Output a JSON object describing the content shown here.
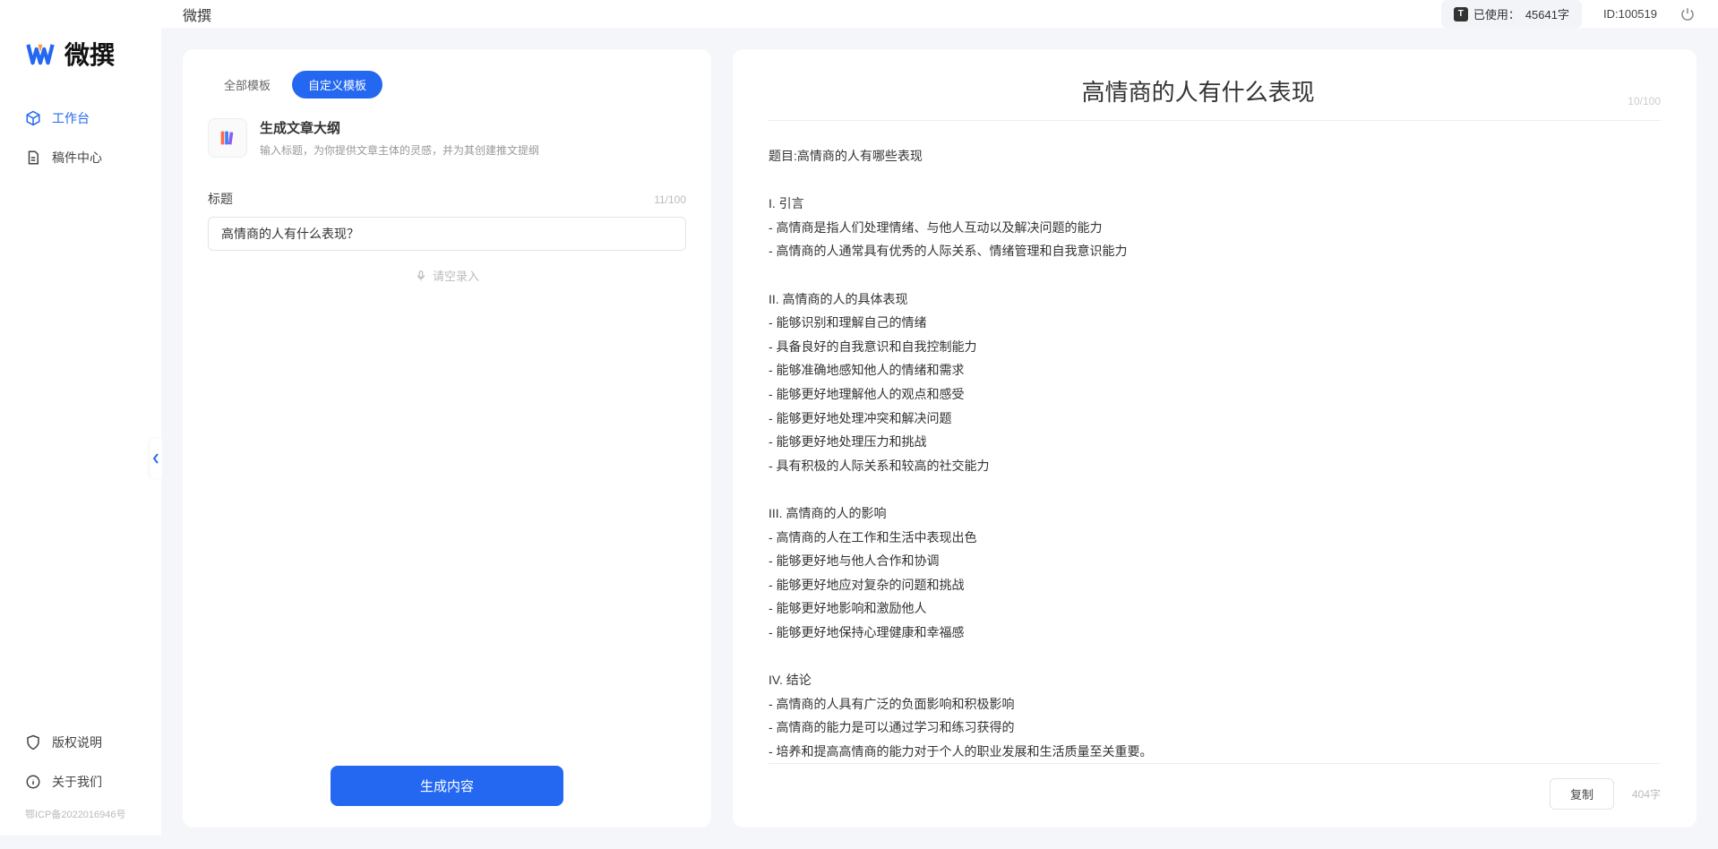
{
  "app": {
    "logo_text": "微撰",
    "title": "微撰"
  },
  "sidebar": {
    "nav": [
      {
        "label": "工作台",
        "active": true
      },
      {
        "label": "稿件中心",
        "active": false
      }
    ],
    "bottom": [
      {
        "label": "版权说明"
      },
      {
        "label": "关于我们"
      }
    ],
    "icp": "鄂ICP备2022016946号"
  },
  "topbar": {
    "usage_label": "已使用：",
    "usage_value": "45641字",
    "user_id_label": "ID:",
    "user_id_value": "100519"
  },
  "left_panel": {
    "tabs": [
      {
        "label": "全部模板",
        "active": false
      },
      {
        "label": "自定义模板",
        "active": true
      }
    ],
    "template": {
      "title": "生成文章大纲",
      "desc": "输入标题，为你提供文章主体的灵感，并为其创建推文提纲"
    },
    "field": {
      "label": "标题",
      "counter": "11/100",
      "value": "高情商的人有什么表现？"
    },
    "voice_label": "请空录入",
    "generate_btn": "生成内容"
  },
  "right_panel": {
    "title": "高情商的人有什么表现",
    "title_counter": "10/100",
    "body": "题目:高情商的人有哪些表现\n\nI. 引言\n- 高情商是指人们处理情绪、与他人互动以及解决问题的能力\n- 高情商的人通常具有优秀的人际关系、情绪管理和自我意识能力\n\nII. 高情商的人的具体表现\n- 能够识别和理解自己的情绪\n- 具备良好的自我意识和自我控制能力\n- 能够准确地感知他人的情绪和需求\n- 能够更好地理解他人的观点和感受\n- 能够更好地处理冲突和解决问题\n- 能够更好地处理压力和挑战\n- 具有积极的人际关系和较高的社交能力\n\nIII. 高情商的人的影响\n- 高情商的人在工作和生活中表现出色\n- 能够更好地与他人合作和协调\n- 能够更好地应对复杂的问题和挑战\n- 能够更好地影响和激励他人\n- 能够更好地保持心理健康和幸福感\n\nIV. 结论\n- 高情商的人具有广泛的负面影响和积极影响\n- 高情商的能力是可以通过学习和练习获得的\n- 培养和提高高情商的能力对于个人的职业发展和生活质量至关重要。",
    "copy_btn": "复制",
    "char_count": "404字"
  }
}
